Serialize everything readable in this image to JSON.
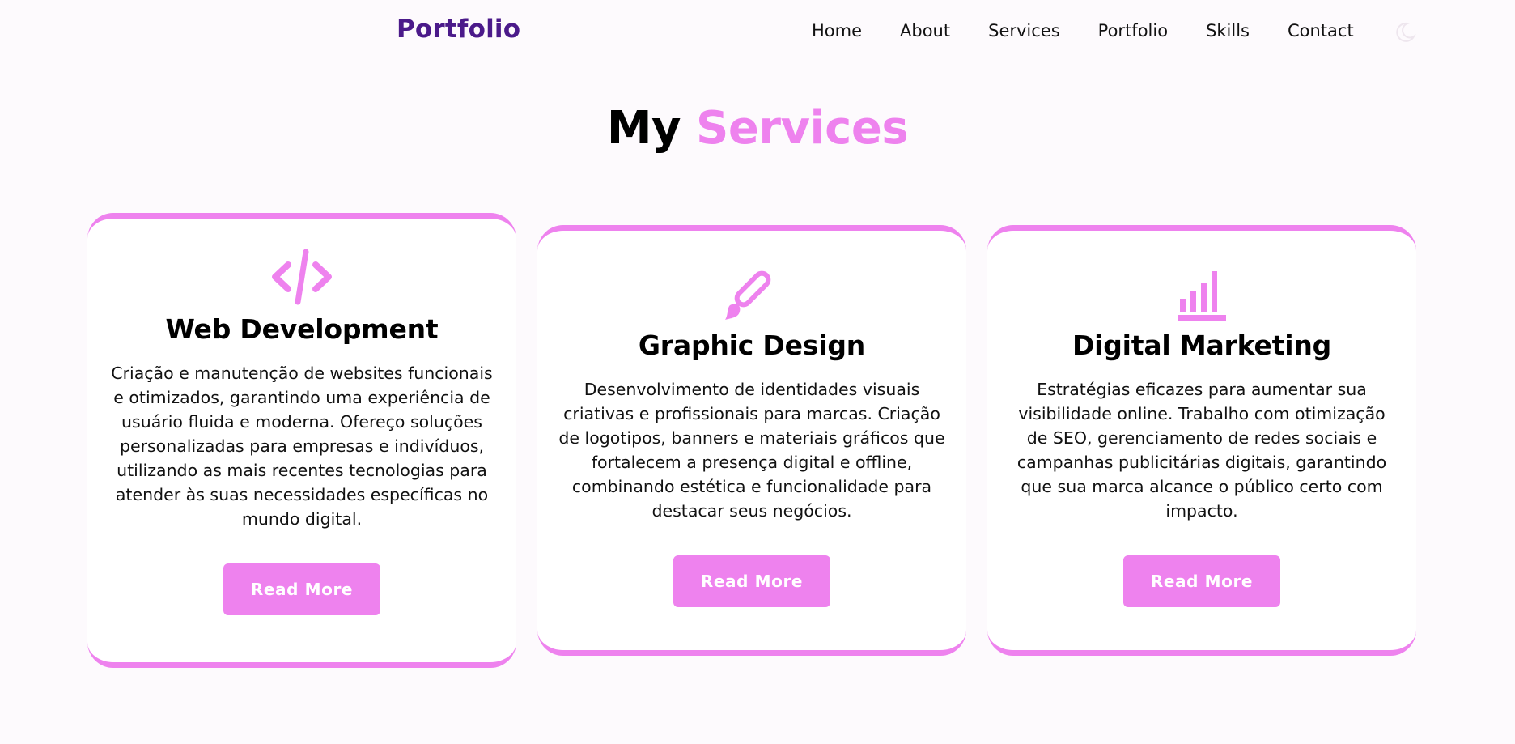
{
  "header": {
    "logo": "Portfolio",
    "nav": [
      "Home",
      "About",
      "Services",
      "Portfolio",
      "Skills",
      "Contact"
    ]
  },
  "section": {
    "title_plain": "My",
    "title_accent": "Services"
  },
  "cards": [
    {
      "icon": "code-icon",
      "title": "Web Development",
      "text": "Criação e manutenção de websites funcionais e otimizados, garantindo uma experiência de usuário fluida e moderna. Ofereço soluções personalizadas para empresas e indivíduos, utilizando as mais recentes tecnologias para atender às suas necessidades específicas no mundo digital.",
      "button": "Read More"
    },
    {
      "icon": "brush-icon",
      "title": "Graphic Design",
      "text": "Desenvolvimento de identidades visuais criativas e profissionais para marcas. Criação de logotipos, banners e materiais gráficos que fortalecem a presença digital e offline, combinando estética e funcionalidade para destacar seus negócios.",
      "button": "Read More"
    },
    {
      "icon": "bar-chart-icon",
      "title": "Digital Marketing",
      "text": "Estratégias eficazes para aumentar sua visibilidade online. Trabalho com otimização de SEO, gerenciamento de redes sociais e campanhas publicitárias digitais, garantindo que sua marca alcance o público certo com impacto.",
      "button": "Read More"
    }
  ],
  "colors": {
    "accent": "#ee82ee",
    "logo": "#4b1a8a",
    "background": "#fdfafd"
  }
}
